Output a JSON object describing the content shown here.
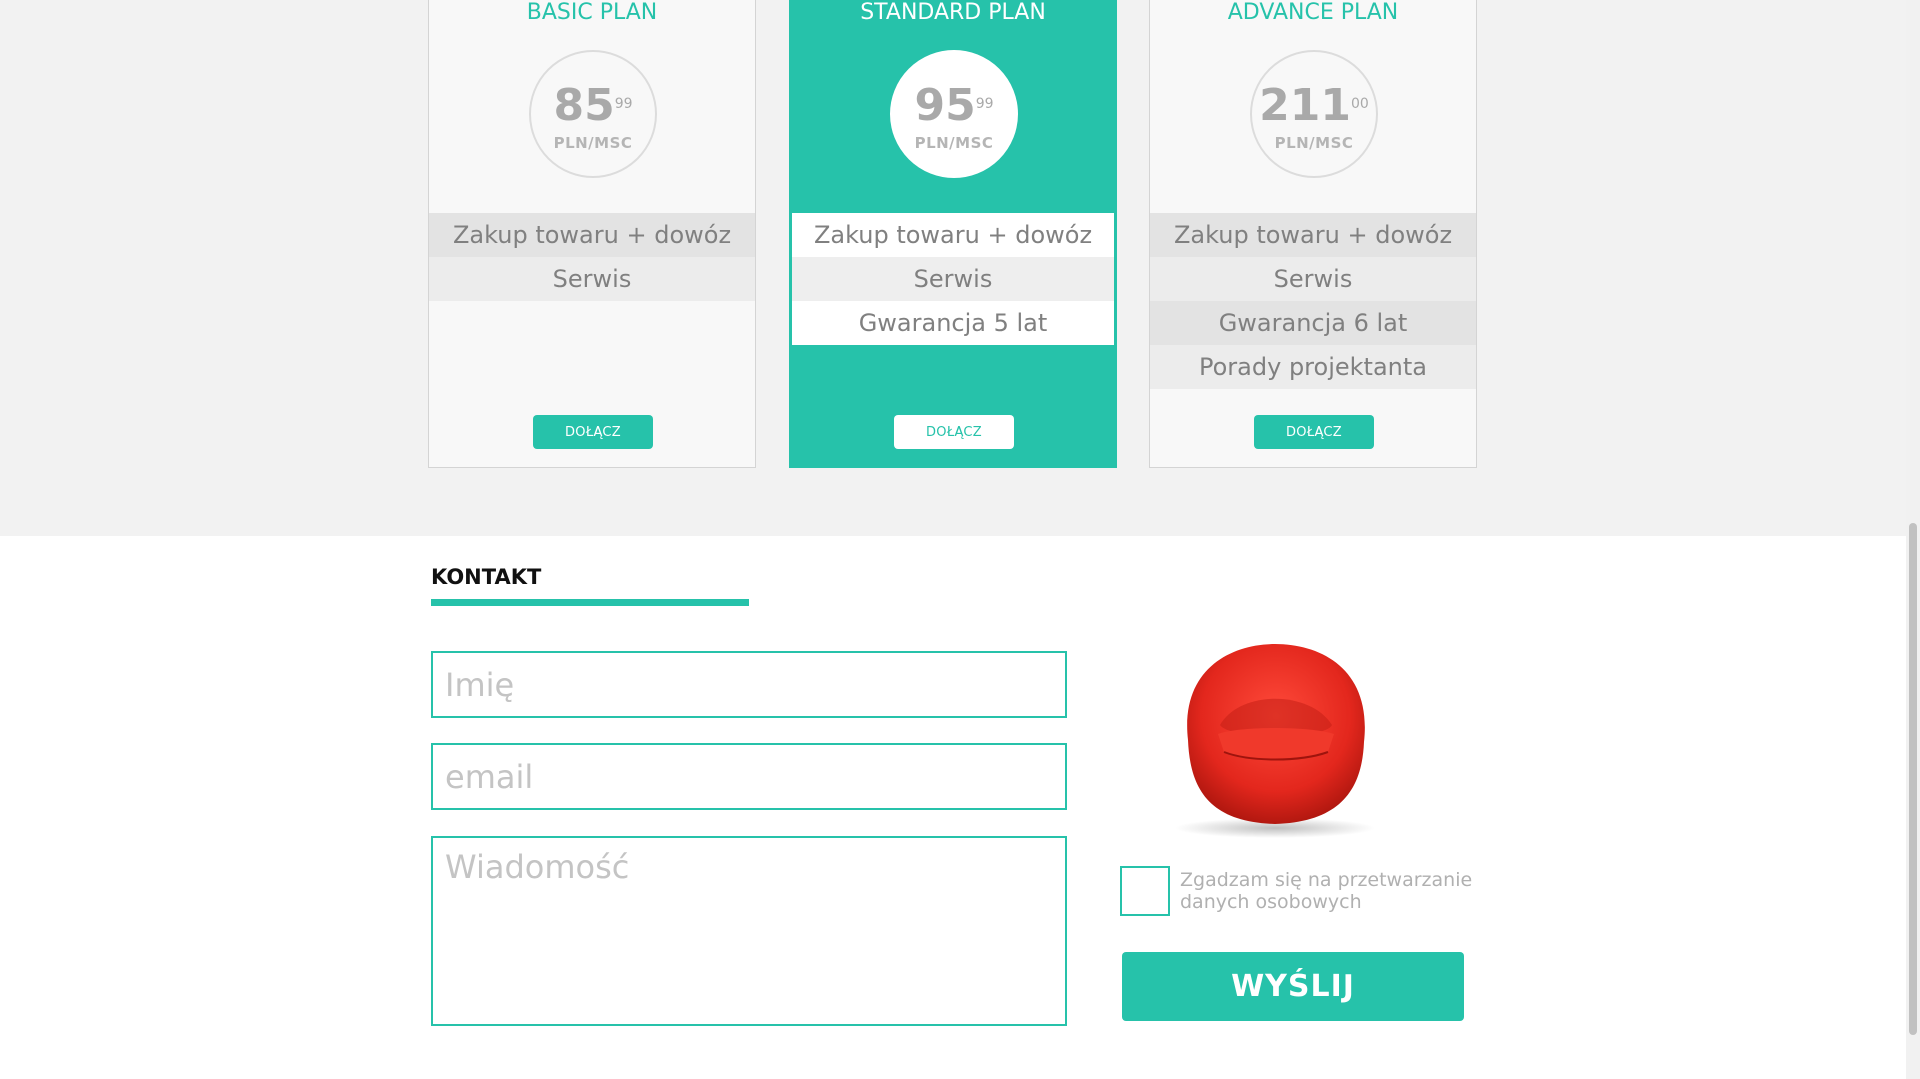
{
  "colors": {
    "accent": "#26c2aa",
    "chair": "#e8322a"
  },
  "plans": [
    {
      "title": "BASIC PLAN",
      "price_main": "85",
      "price_cents": "99",
      "price_unit": "PLN/MSC",
      "features": [
        "Zakup towaru + dowóz",
        "Serwis"
      ],
      "button": "DOŁĄCZ"
    },
    {
      "title": "STANDARD PLAN",
      "price_main": "95",
      "price_cents": "99",
      "price_unit": "PLN/MSC",
      "features": [
        "Zakup towaru + dowóz",
        "Serwis",
        "Gwarancja 5 lat"
      ],
      "button": "DOŁĄCZ"
    },
    {
      "title": "ADVANCE PLAN",
      "price_main": "211",
      "price_cents": "00",
      "price_unit": "PLN/MSC",
      "features": [
        "Zakup towaru + dowóz",
        "Serwis",
        "Gwarancja 6 lat",
        "Porady projektanta"
      ],
      "button": "DOŁĄCZ"
    }
  ],
  "contact": {
    "title": "KONTAKT",
    "name_placeholder": "Imię",
    "email_placeholder": "email",
    "message_placeholder": "Wiadomość",
    "consent_label": "Zgadzam się na przetwarzanie danych osobowych",
    "send_label": "WYŚLIJ",
    "image_icon": "red-armchair"
  }
}
